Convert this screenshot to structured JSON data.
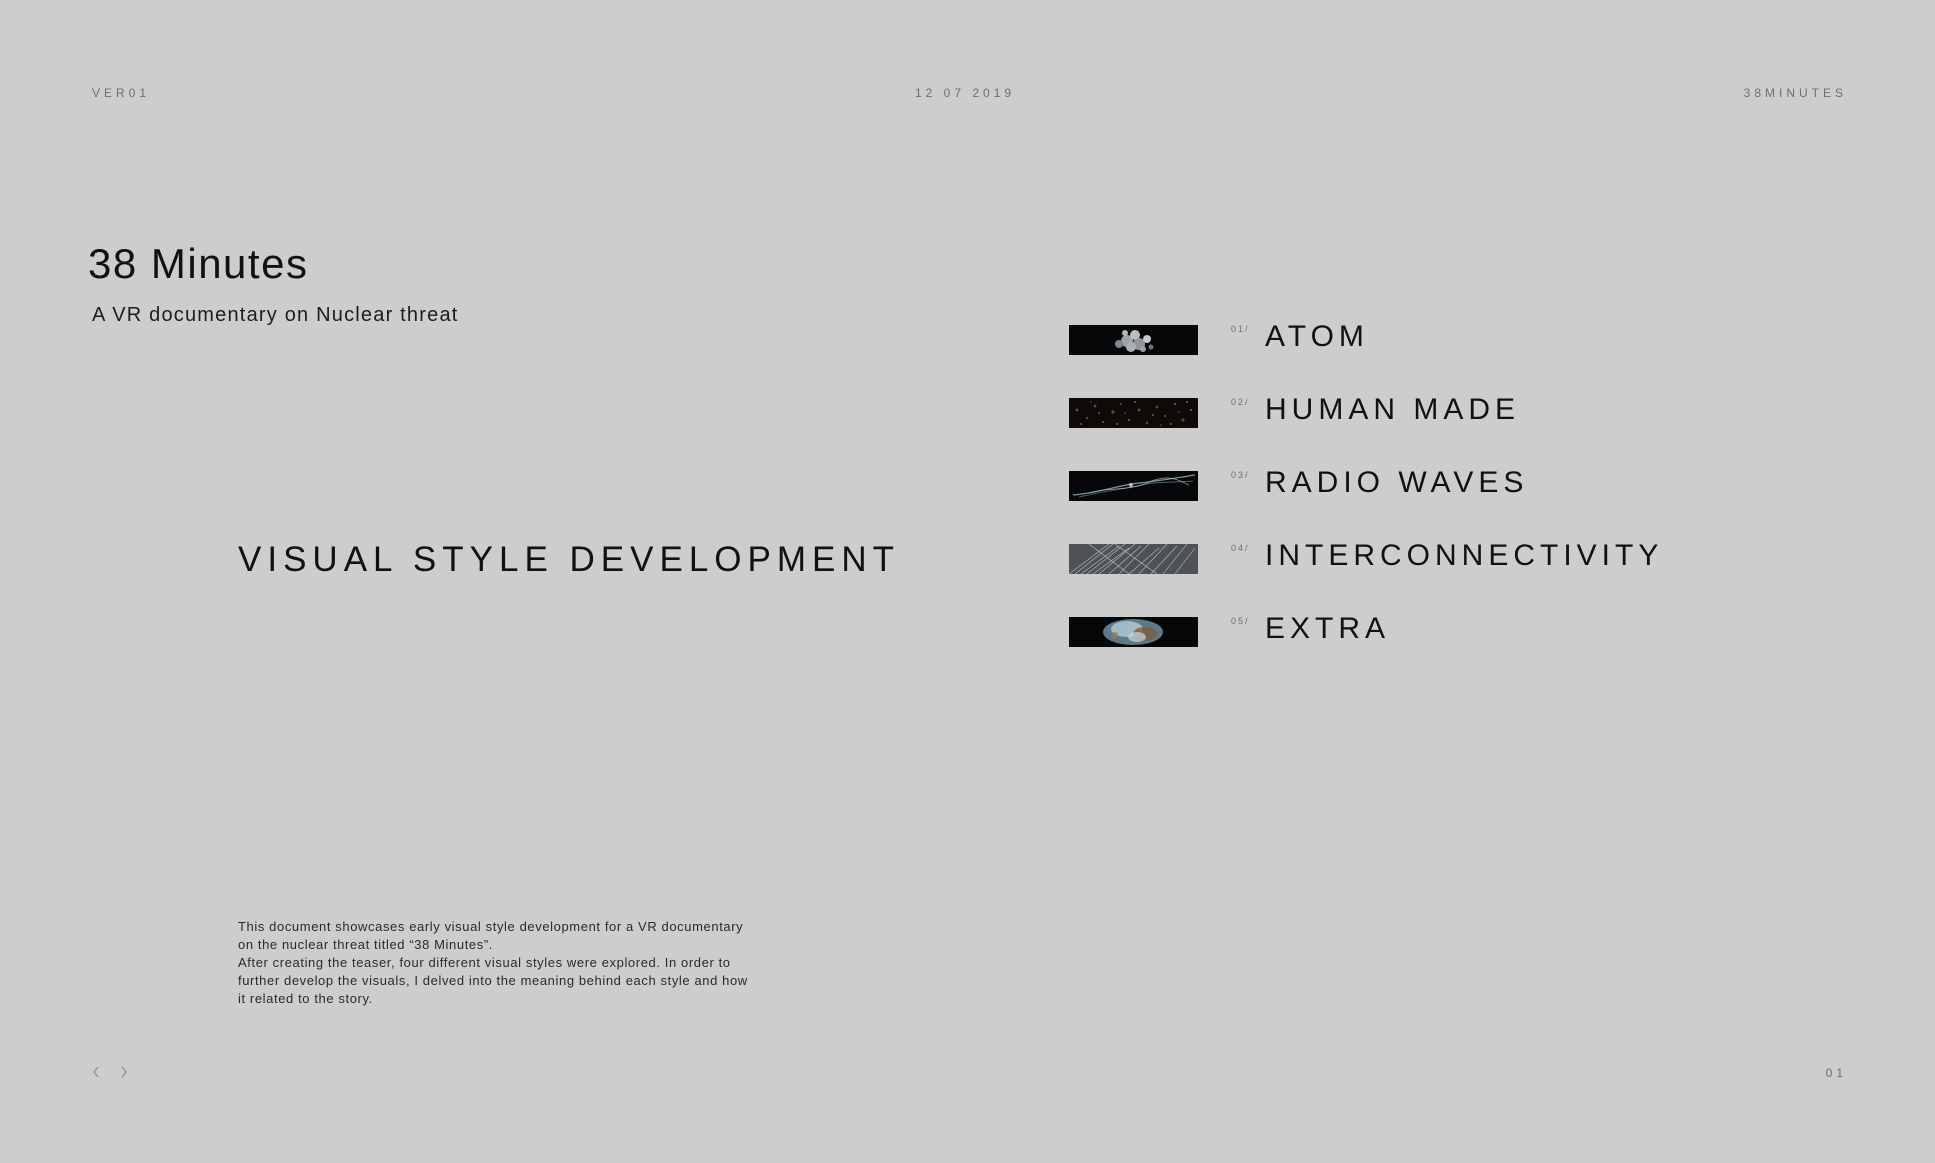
{
  "header": {
    "version": "VER01",
    "date": "12 07 2019",
    "project": "38MINUTES"
  },
  "title": "38 Minutes",
  "subtitle": "A VR documentary on Nuclear threat",
  "section_heading": "VISUAL STYLE DEVELOPMENT",
  "description": [
    "This document showcases early visual style development for a VR documentary on the nuclear threat titled “38 Minutes”.",
    "After creating the teaser, four different visual styles were explored. In order to further develop the visuals, I delved into the meaning behind each style and how it related to the story."
  ],
  "toc": [
    {
      "number": "01/",
      "label": "ATOM"
    },
    {
      "number": "02/",
      "label": "HUMAN MADE"
    },
    {
      "number": "03/",
      "label": "RADIO WAVES"
    },
    {
      "number": "04/",
      "label": "INTERCONNECTIVITY"
    },
    {
      "number": "05/",
      "label": "EXTRA"
    }
  ],
  "footer": {
    "page_number": "01",
    "prev_icon": "chevron-left-icon",
    "next_icon": "chevron-right-icon"
  },
  "colors": {
    "background": "#cdcdcd",
    "text": "#111111",
    "meta_text": "#6e6e6e",
    "thumbnail_bg": "#050708"
  }
}
